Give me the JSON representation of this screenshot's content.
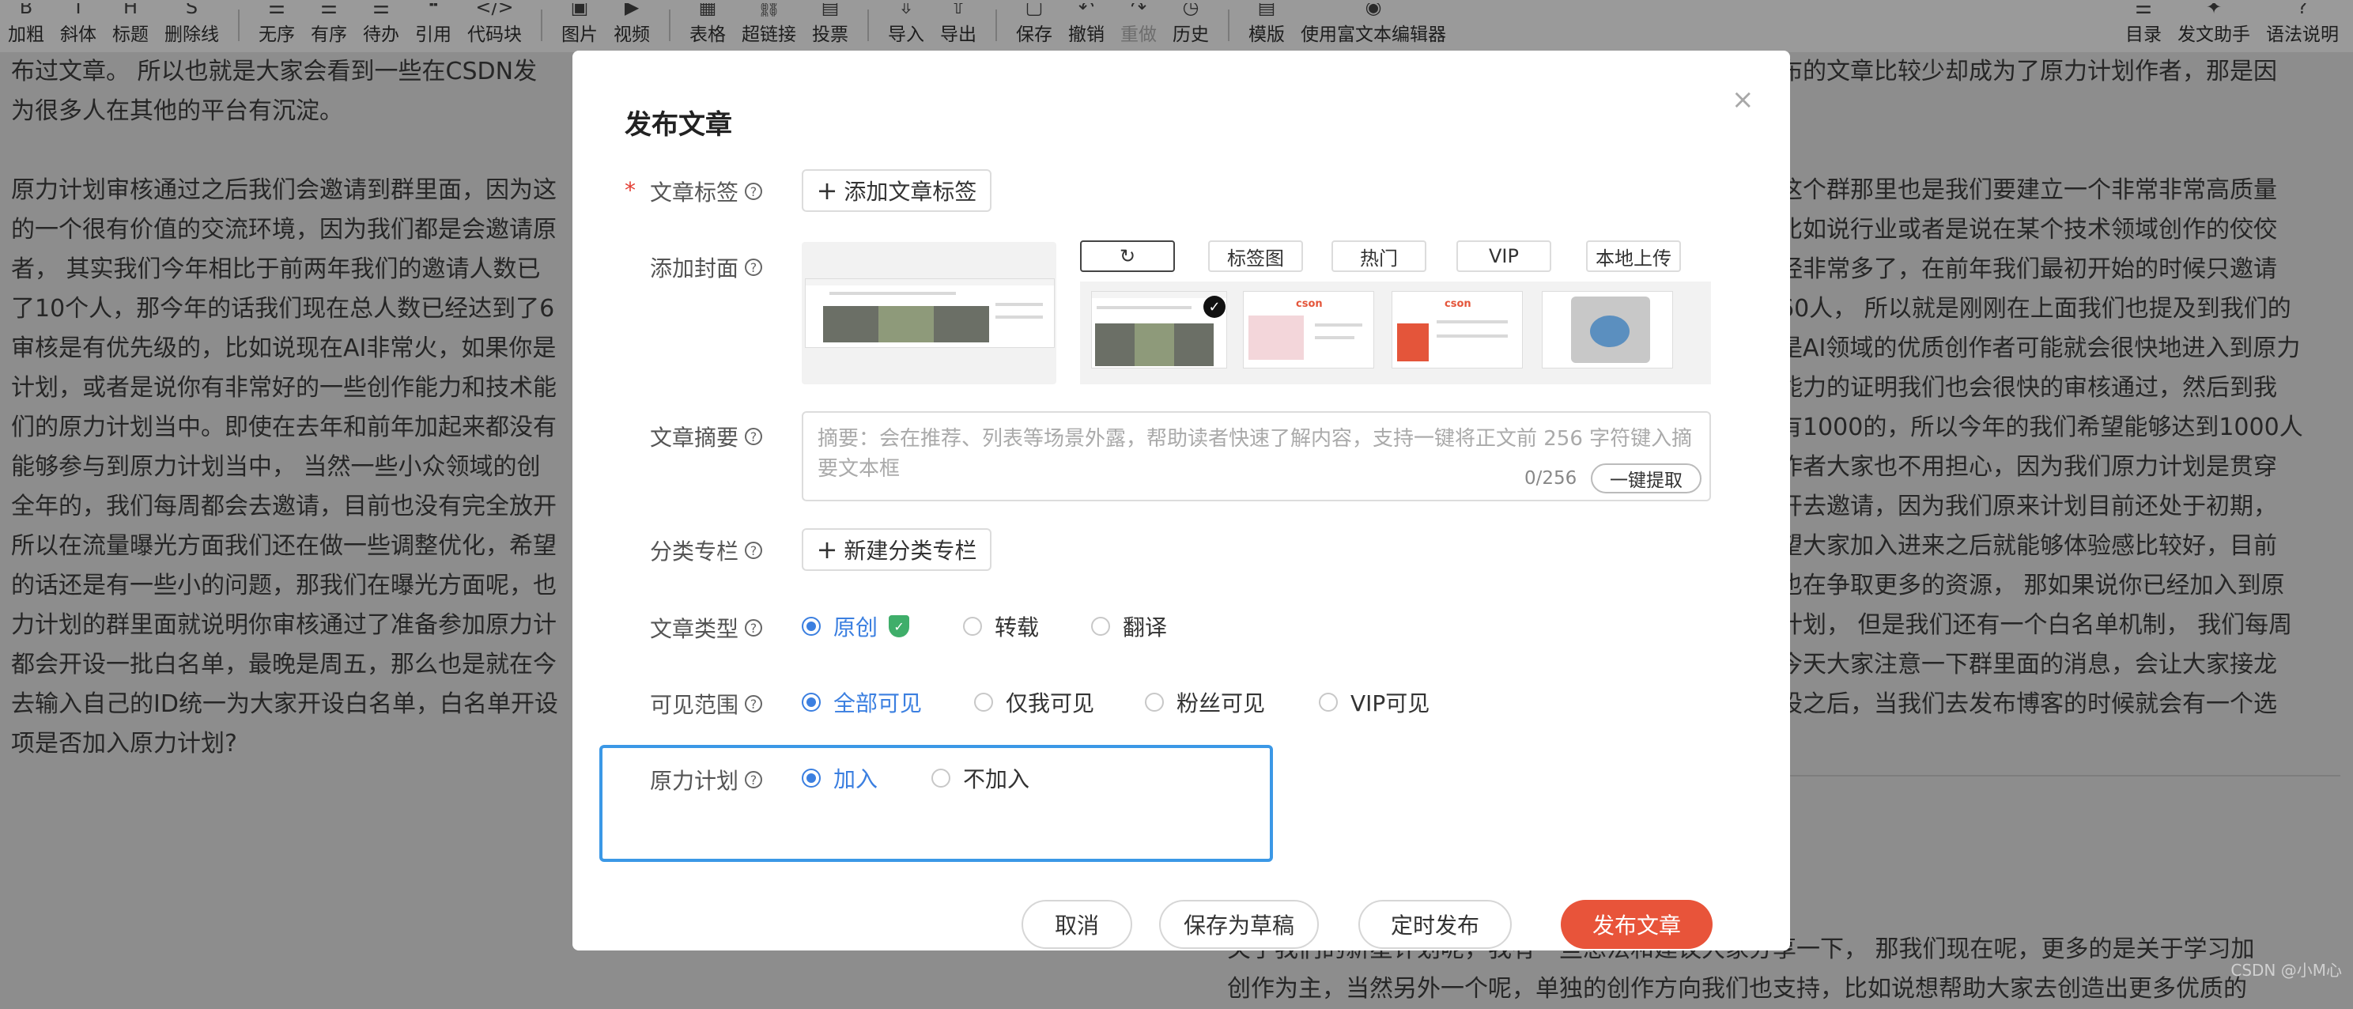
{
  "toolbar": {
    "items": [
      {
        "label": "加粗",
        "icon": "bold-icon"
      },
      {
        "label": "斜体",
        "icon": "italic-icon"
      },
      {
        "label": "标题",
        "icon": "heading-icon"
      },
      {
        "label": "删除线",
        "icon": "strikethrough-icon"
      },
      {
        "label": "无序",
        "icon": "unordered-list-icon"
      },
      {
        "label": "有序",
        "icon": "ordered-list-icon"
      },
      {
        "label": "待办",
        "icon": "todo-list-icon"
      },
      {
        "label": "引用",
        "icon": "quote-icon"
      },
      {
        "label": "代码块",
        "icon": "code-block-icon"
      },
      {
        "label": "图片",
        "icon": "image-icon"
      },
      {
        "label": "视频",
        "icon": "video-icon"
      },
      {
        "label": "表格",
        "icon": "table-icon"
      },
      {
        "label": "超链接",
        "icon": "link-icon"
      },
      {
        "label": "投票",
        "icon": "vote-icon"
      },
      {
        "label": "导入",
        "icon": "import-icon"
      },
      {
        "label": "导出",
        "icon": "export-icon"
      },
      {
        "label": "保存",
        "icon": "save-icon"
      },
      {
        "label": "撤销",
        "icon": "undo-icon"
      },
      {
        "label": "重做",
        "icon": "redo-icon"
      },
      {
        "label": "历史",
        "icon": "history-icon"
      },
      {
        "label": "模版",
        "icon": "template-icon"
      },
      {
        "label": "使用富文本编辑器",
        "icon": "rich-text-icon"
      }
    ],
    "right_items": [
      {
        "label": "目录",
        "icon": "toc-icon"
      },
      {
        "label": "发文助手",
        "icon": "assistant-icon"
      },
      {
        "label": "语法说明",
        "icon": "syntax-help-icon"
      }
    ]
  },
  "document": {
    "left_lines": [
      "布过文章。 所以也就是大家会看到一些在CSDN发",
      "为很多人在其他的平台有沉淀。",
      "",
      "原力计划审核通过之后我们会邀请到群里面，因为这",
      "的一个很有价值的交流环境，因为我们都是会邀请原",
      "者， 其实我们今年相比于前两年我们的邀请人数已",
      "了10个人，那今年的话我们现在总人数已经达到了6",
      "审核是有优先级的，比如说现在AI非常火，如果你是",
      "计划，或者是说你有非常好的一些创作能力和技术能",
      "们的原力计划当中。即使在去年和前年加起来都没有",
      "能够参与到原力计划当中， 当然一些小众领域的创",
      "全年的，我们每周都会去邀请，目前也没有完全放开",
      "所以在流量曝光方面我们还在做一些调整优化，希望",
      "的话还是有一些小的问题，那我们在曝光方面呢，也",
      "力计划的群里面就说明你审核通过了准备参加原力计",
      "都会开设一批白名单，最晚是周五，那么也是就在今",
      "去输入自己的ID统一为大家开设白名单，白名单开设",
      "项是否加入原力计划?"
    ],
    "right_lines": [
      "布的文章比较少却成为了原力计划作者，那是因",
      "",
      "",
      "这个群那里也是我们要建立一个非常非常高质量",
      "比如说行业或者是说在某个技术领域创作的佼佼",
      "经非常多了，在前年我们最初开始的时候只邀请",
      "60人， 所以就是刚刚在上面我们也提及到我们的",
      "是AI领域的优质创作者可能就会很快地进入到原力",
      "能力的证明我们也会很快的审核通过，然后到我",
      "有1000的，所以今年的我们希望能够达到1000人",
      "作者大家也不用担心，因为我们原力计划是贯穿",
      "开去邀请，因为我们原来计划目前还处于初期，",
      "望大家加入进来之后就能够体验感比较好，目前",
      "也在争取更多的资源， 那如果说你已经加入到原",
      "计划， 但是我们还有一个白名单机制， 我们每周",
      "今天大家注意一下群里面的消息，会让大家接龙",
      "设之后，当我们去发布博客的时候就会有一个选"
    ],
    "bottom_lines": [
      "关于我们的新星计划呢，我有一些想法和建议大家分享一下， 那我们现在呢，更多的是关于学习加",
      "创作为主，当然另外一个呢，单独的创作方向我们也支持，比如说想帮助大家去创造出更多优质的"
    ],
    "watermark": "CSDN @小M心"
  },
  "modal": {
    "title": "发布文章",
    "tags": {
      "label": "文章标签",
      "add_button": "添加文章标签"
    },
    "cover": {
      "label": "添加封面",
      "tabs": [
        "",
        "标签图",
        "热门",
        "VIP",
        "本地上传"
      ]
    },
    "summary": {
      "label": "文章摘要",
      "placeholder": "摘要：会在推荐、列表等场景外露，帮助读者快速了解内容，支持一键将正文前 256 字符键入摘要文本框",
      "count": "0/256",
      "extract_button": "一键提取"
    },
    "column": {
      "label": "分类专栏",
      "add_button": "新建分类专栏"
    },
    "type": {
      "label": "文章类型",
      "options": [
        "原创",
        "转载",
        "翻译"
      ],
      "selected": "原创"
    },
    "visibility": {
      "label": "可见范围",
      "options": [
        "全部可见",
        "仅我可见",
        "粉丝可见",
        "VIP可见"
      ],
      "selected": "全部可见"
    },
    "power_plan": {
      "label": "原力计划",
      "options": [
        "加入",
        "不加入"
      ],
      "selected": "加入"
    },
    "footer": {
      "cancel": "取消",
      "save_draft": "保存为草稿",
      "schedule": "定时发布",
      "publish": "发布文章"
    }
  },
  "colors": {
    "primary": "#e8543a",
    "accent_blue": "#3b7fe0",
    "highlight_border": "#3b98e6",
    "overlay": "#8d8d8d"
  }
}
